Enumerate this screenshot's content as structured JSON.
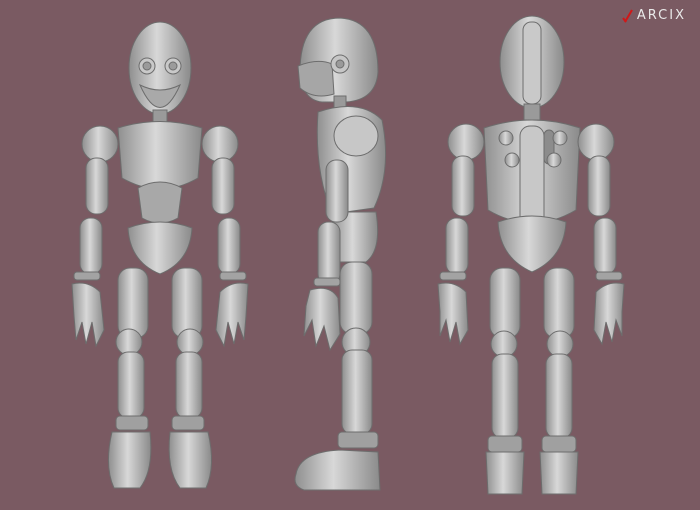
{
  "brand": {
    "logo_text": "ARCIX"
  },
  "colors": {
    "background": "#7a5a62",
    "model": "#bdbdbd",
    "logo_mark": "#d01818"
  },
  "scene": {
    "views": [
      {
        "view_label": "front"
      },
      {
        "view_label": "side"
      },
      {
        "view_label": "back"
      }
    ]
  }
}
